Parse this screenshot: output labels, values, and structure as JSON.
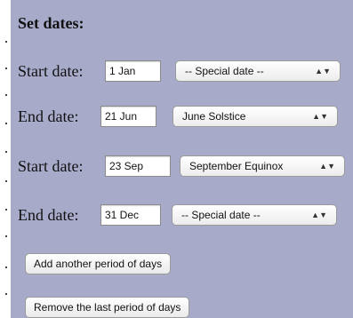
{
  "form": {
    "title": "Set dates:",
    "periods": [
      {
        "start_label": "Start date:",
        "start_value": "1 Jan",
        "start_special": "-- Special date --",
        "end_label": "End date:",
        "end_value": "21 Jun",
        "end_special": "June Solstice"
      },
      {
        "start_label": "Start date:",
        "start_value": "23 Sep",
        "start_special": "September Equinox",
        "end_label": "End date:",
        "end_value": "31 Dec",
        "end_special": "-- Special date --"
      }
    ],
    "add_button": "Add another period of days",
    "remove_button": "Remove the last period of days"
  },
  "icons": {
    "select_arrows": "updown-arrows-icon"
  },
  "colors": {
    "panel_background": "#a7aac9",
    "page_background": "#ffffff"
  }
}
